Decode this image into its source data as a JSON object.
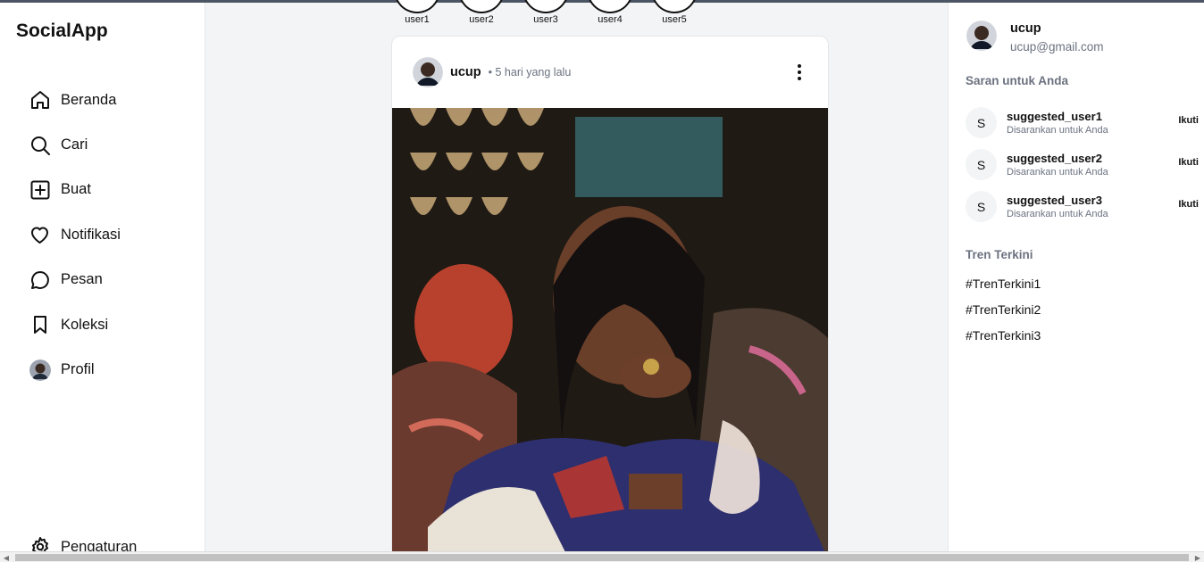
{
  "app": {
    "logo": "SocialApp"
  },
  "nav": {
    "items": [
      {
        "label": "Beranda",
        "icon": "home-icon"
      },
      {
        "label": "Cari",
        "icon": "search-icon"
      },
      {
        "label": "Buat",
        "icon": "plus-square-icon"
      },
      {
        "label": "Notifikasi",
        "icon": "heart-icon"
      },
      {
        "label": "Pesan",
        "icon": "message-circle-icon"
      },
      {
        "label": "Koleksi",
        "icon": "bookmark-icon"
      },
      {
        "label": "Profil",
        "icon": "avatar"
      }
    ],
    "settings": {
      "label": "Pengaturan",
      "icon": "gear-icon"
    }
  },
  "stories": [
    "user1",
    "user2",
    "user3",
    "user4",
    "user5"
  ],
  "post": {
    "username": "ucup",
    "time": "• 5 hari yang lalu",
    "more_icon": "more-vertical-icon"
  },
  "profile": {
    "name": "ucup",
    "email": "ucup@gmail.com"
  },
  "suggestions": {
    "title": "Saran untuk Anda",
    "items": [
      {
        "initial": "S",
        "username": "suggested_user1",
        "subtitle": "Disarankan untuk Anda",
        "action": "Ikuti"
      },
      {
        "initial": "S",
        "username": "suggested_user2",
        "subtitle": "Disarankan untuk Anda",
        "action": "Ikuti"
      },
      {
        "initial": "S",
        "username": "suggested_user3",
        "subtitle": "Disarankan untuk Anda",
        "action": "Ikuti"
      }
    ]
  },
  "trends": {
    "title": "Tren Terkini",
    "items": [
      "#TrenTerkini1",
      "#TrenTerkini2",
      "#TrenTerkini3"
    ]
  },
  "colors": {
    "text": "#111111",
    "muted": "#6b7280",
    "background": "#f3f4f6",
    "border": "#e5e7eb"
  }
}
